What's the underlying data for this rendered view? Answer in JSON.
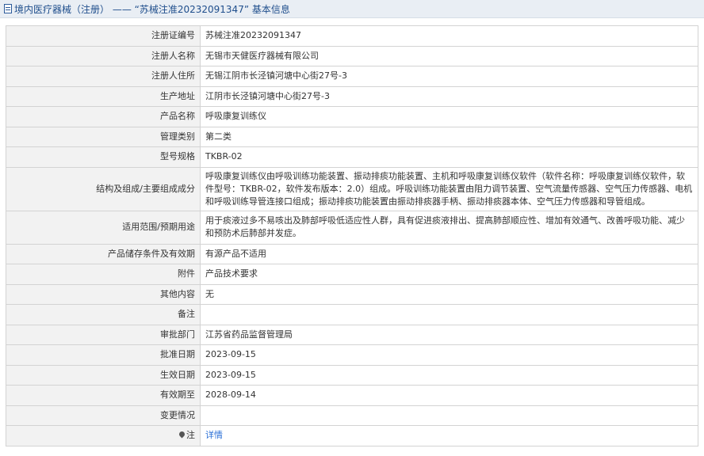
{
  "header": {
    "title": "境内医疗器械（注册） —— “苏械注准20232091347” 基本信息"
  },
  "rows": [
    {
      "label": "注册证编号",
      "value": "苏械注准20232091347"
    },
    {
      "label": "注册人名称",
      "value": "无锡市天健医疗器械有限公司"
    },
    {
      "label": "注册人住所",
      "value": "无锡江阴市长泾镇河塘中心街27号-3"
    },
    {
      "label": "生产地址",
      "value": "江阴市长泾镇河塘中心街27号-3"
    },
    {
      "label": "产品名称",
      "value": "呼吸康复训练仪"
    },
    {
      "label": "管理类别",
      "value": "第二类"
    },
    {
      "label": "型号规格",
      "value": "TKBR-02"
    },
    {
      "label": "结构及组成/主要组成成分",
      "value": "呼吸康复训练仪由呼吸训练功能装置、振动排痰功能装置、主机和呼吸康复训练仪软件（软件名称：呼吸康复训练仪软件，软件型号：TKBR-02，软件发布版本：2.0）组成。呼吸训练功能装置由阻力调节装置、空气流量传感器、空气压力传感器、电机和呼吸训练导管连接口组成；振动排痰功能装置由振动排痰器手柄、振动排痰器本体、空气压力传感器和导管组成。"
    },
    {
      "label": "适用范围/预期用途",
      "value": "用于痰液过多不易咳出及肺部呼吸低适应性人群，具有促进痰液排出、提高肺部顺应性、增加有效通气、改善呼吸功能、减少和预防术后肺部并发症。"
    },
    {
      "label": "产品储存条件及有效期",
      "value": "有源产品不适用"
    },
    {
      "label": "附件",
      "value": "产品技术要求"
    },
    {
      "label": "其他内容",
      "value": "无"
    },
    {
      "label": "备注",
      "value": ""
    },
    {
      "label": "审批部门",
      "value": "江苏省药品监督管理局"
    },
    {
      "label": "批准日期",
      "value": "2023-09-15"
    },
    {
      "label": "生效日期",
      "value": "2023-09-15"
    },
    {
      "label": "有效期至",
      "value": "2028-09-14"
    },
    {
      "label": "变更情况",
      "value": ""
    }
  ],
  "note": {
    "label": "注",
    "icon": "pin-icon",
    "link_text": "详情",
    "link_color": "#2a6fd6"
  }
}
